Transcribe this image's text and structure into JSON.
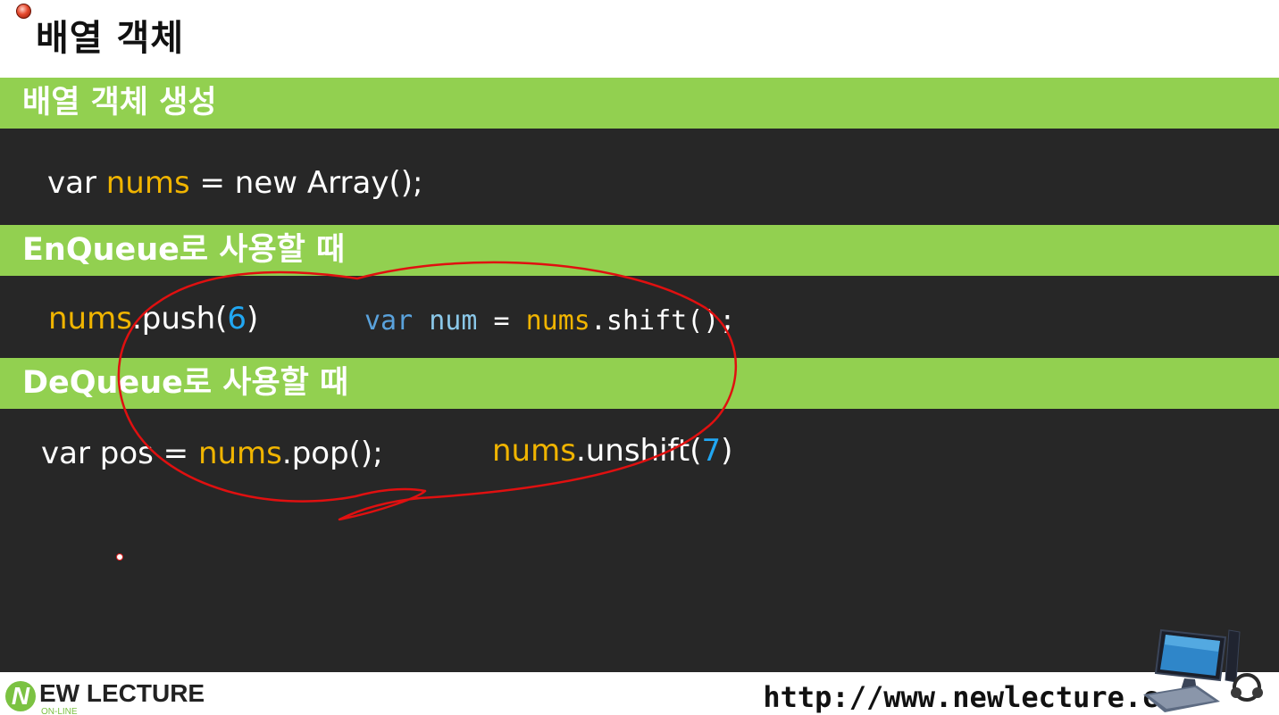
{
  "slide": {
    "title": "배열 객체"
  },
  "sections": [
    {
      "heading": "배열 객체 생성",
      "code": {
        "kw1": "var ",
        "ident": "nums",
        "rest": " = new Array();"
      }
    },
    {
      "heading": "EnQueue로 사용할 때",
      "code_left": {
        "obj": "nums",
        "method": ".push(",
        "arg": "6",
        "close": ")"
      },
      "code_right": {
        "kw": "var",
        "sp1": " ",
        "ident": "num",
        "eq": " = ",
        "obj": "nums",
        "call": ".shift();"
      }
    },
    {
      "heading": "DeQueue로 사용할 때",
      "code_left": {
        "pre": "var pos = ",
        "obj": "nums",
        "call": ".pop();"
      },
      "code_right": {
        "obj": "nums",
        "method": ".unshift(",
        "arg": "7",
        "close": ")"
      }
    }
  ],
  "footer": {
    "logo_letter": "N",
    "logo_text": "EW LECTURE",
    "logo_sub": "ON-LINE",
    "url": "http://www.newlecture.com"
  },
  "colors": {
    "section_green": "#92d050",
    "body_dark": "#272727",
    "highlight_yellow": "#f0b400",
    "number_blue": "#21a7f2",
    "annotation_red": "#e01010"
  }
}
